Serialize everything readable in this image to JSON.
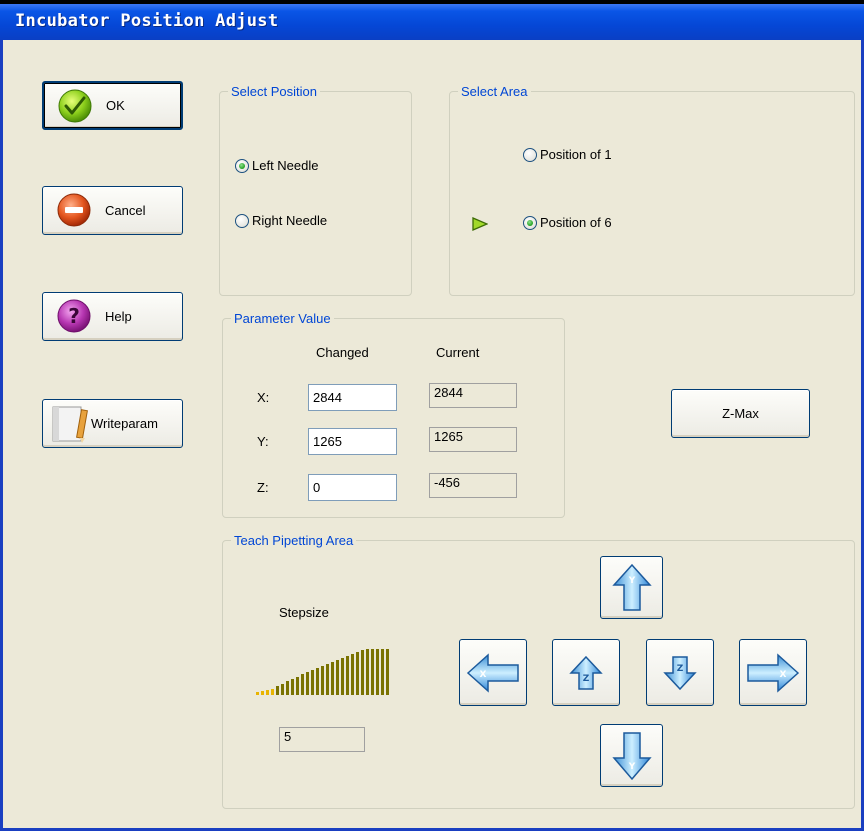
{
  "window": {
    "title": "Incubator Position Adjust"
  },
  "buttons": {
    "ok": "OK",
    "cancel": "Cancel",
    "help": "Help",
    "writeparam": "Writeparam",
    "zmax": "Z-Max"
  },
  "select_position": {
    "legend": "Select Position",
    "options": [
      {
        "label": "Left Needle",
        "selected": true
      },
      {
        "label": "Right Needle",
        "selected": false
      }
    ]
  },
  "select_area": {
    "legend": "Select Area",
    "options": [
      {
        "label": "Position of 1",
        "selected": false
      },
      {
        "label": "Position of 6",
        "selected": true
      }
    ]
  },
  "parameter_value": {
    "legend": "Parameter Value",
    "col_changed": "Changed",
    "col_current": "Current",
    "rows": [
      {
        "axis": "X:",
        "changed": "2844",
        "current": "2844"
      },
      {
        "axis": "Y:",
        "changed": "1265",
        "current": "1265"
      },
      {
        "axis": "Z:",
        "changed": "0",
        "current": "-456"
      }
    ]
  },
  "teach": {
    "legend": "Teach Pipetting Area",
    "stepsize_label": "Stepsize",
    "stepsize_value": "5"
  },
  "colors": {
    "titlebar": "#0a55e6",
    "legend_text": "#0046d5",
    "stepsize_bar": "#7a7200",
    "stepsize_small": "#e8b400"
  }
}
